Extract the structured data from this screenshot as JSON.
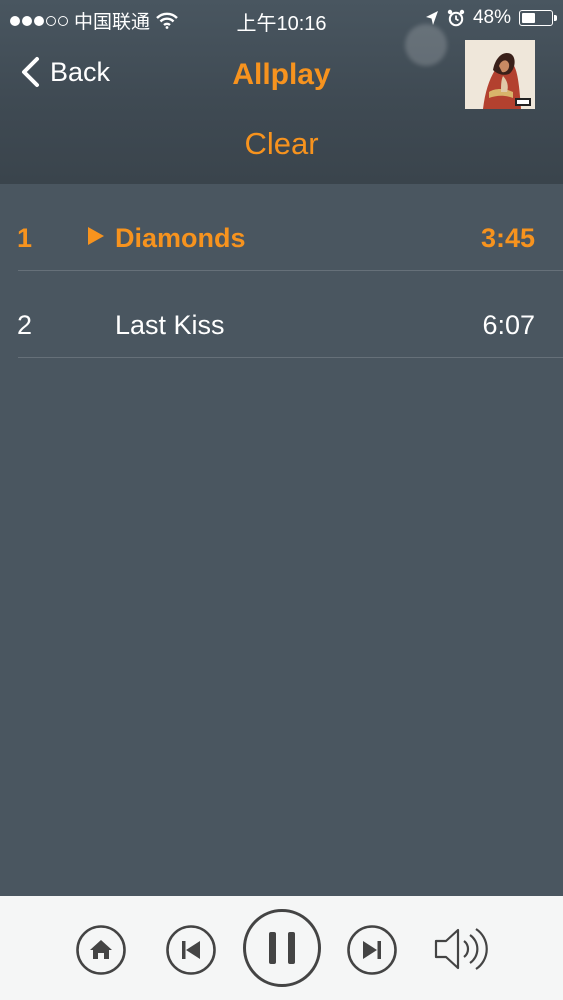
{
  "status_bar": {
    "carrier": "中国联通",
    "time": "上午10:16",
    "battery": "48%",
    "battery_level": 0.48
  },
  "nav": {
    "back_label": "Back",
    "title": "Allplay",
    "clear_label": "Clear"
  },
  "colors": {
    "accent": "#f7931e",
    "background": "#4a5660",
    "controls_bar": "#f5f6f6"
  },
  "playlist": [
    {
      "number": "1",
      "title": "Diamonds",
      "duration": "3:45",
      "playing": true
    },
    {
      "number": "2",
      "title": "Last Kiss",
      "duration": "6:07",
      "playing": false
    }
  ],
  "controls": {
    "icons": [
      "home-icon",
      "previous-icon",
      "pause-icon",
      "next-icon",
      "volume-icon"
    ]
  }
}
